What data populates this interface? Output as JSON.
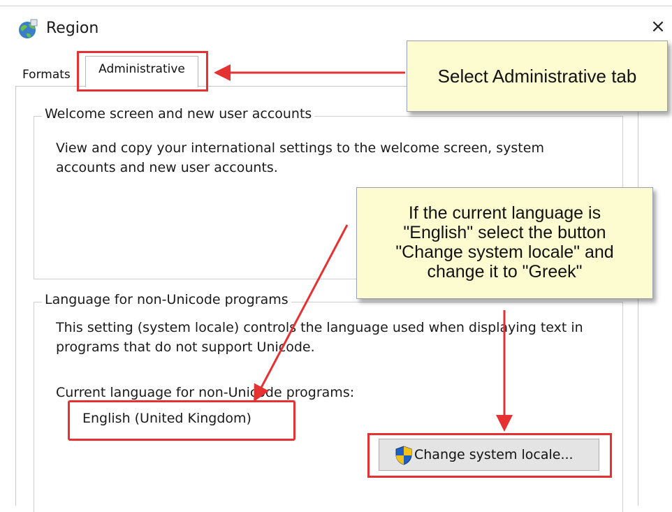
{
  "window": {
    "title": "Region",
    "close_glyph": "×",
    "icon": "globe-icon"
  },
  "tabs": [
    {
      "label": "Formats",
      "selected": false
    },
    {
      "label": "Administrative",
      "selected": true
    }
  ],
  "welcome_group": {
    "legend": "Welcome screen and new user accounts",
    "description": "View and copy your international settings to the welcome screen, system accounts and new user accounts."
  },
  "unicode_group": {
    "legend": "Language for non-Unicode programs",
    "description": "This setting (system locale) controls the language used when displaying text in programs that do not support Unicode.",
    "current_label": "Current language for non-Unicode programs:",
    "current_value": "English (United Kingdom)",
    "change_button": "Change system locale...",
    "button_icon": "uac-shield-icon"
  },
  "annotations": {
    "tab_callout": "Select Administrative tab",
    "locale_callout_lines": [
      "If the current language is",
      "\"English\" select the button",
      "\"Change system locale\" and",
      "change it to \"Greek\""
    ],
    "highlight_color": "#e53131",
    "callout_color": "#fdfcd0"
  }
}
